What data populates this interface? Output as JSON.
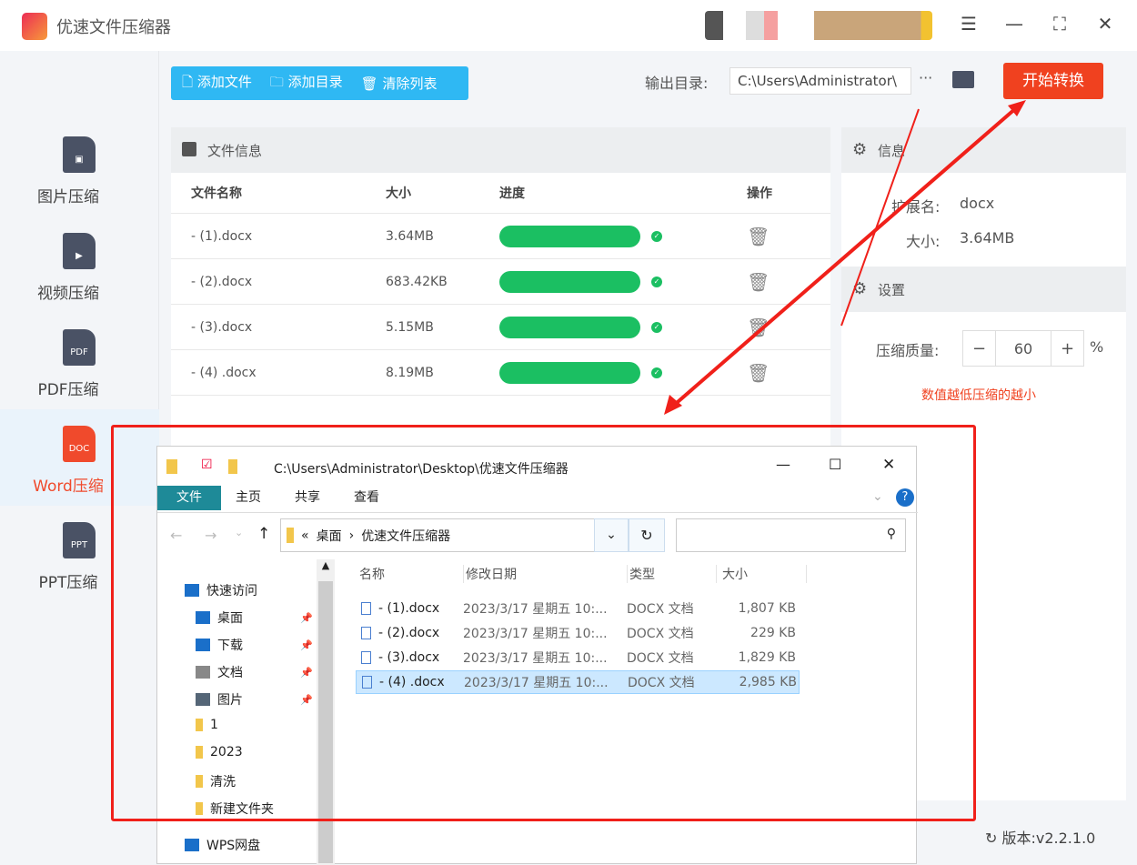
{
  "app": {
    "title": "优速文件压缩器"
  },
  "sidebar": {
    "items": [
      {
        "label": "图片压缩",
        "icon": "image-file-icon",
        "badge": ""
      },
      {
        "label": "视频压缩",
        "icon": "video-file-icon",
        "badge": ""
      },
      {
        "label": "PDF压缩",
        "icon": "pdf-file-icon",
        "badge": "PDF"
      },
      {
        "label": "Word压缩",
        "icon": "doc-file-icon",
        "badge": "DOC"
      },
      {
        "label": "PPT压缩",
        "icon": "ppt-file-icon",
        "badge": "PPT"
      }
    ]
  },
  "toolbar": {
    "add_file": "添加文件",
    "add_folder": "添加目录",
    "clear_list": "清除列表",
    "output_label": "输出目录:",
    "output_path": "C:\\Users\\Administrator\\",
    "more": "···",
    "start": "开始转换"
  },
  "file_panel": {
    "title": "文件信息",
    "columns": [
      "文件名称",
      "大小",
      "进度",
      "操作"
    ],
    "rows": [
      {
        "name": "- (1).docx",
        "size": "3.64MB",
        "progress": 100
      },
      {
        "name": "- (2).docx",
        "size": "683.42KB",
        "progress": 100
      },
      {
        "name": "- (3).docx",
        "size": "5.15MB",
        "progress": 100
      },
      {
        "name": "- (4) .docx",
        "size": "8.19MB",
        "progress": 100
      }
    ]
  },
  "info": {
    "title": "信息",
    "ext_label": "扩展名:",
    "ext": "docx",
    "size_label": "大小:",
    "size": "3.64MB"
  },
  "settings": {
    "title": "设置",
    "quality_label": "压缩质量:",
    "minus": "−",
    "quality": "60",
    "plus": "+",
    "unit": "%",
    "hint": "数值越低压缩的越小"
  },
  "version": "版本:v2.2.1.0",
  "explorer": {
    "title": "C:\\Users\\Administrator\\Desktop\\优速文件压缩器",
    "tabs": [
      "文件",
      "主页",
      "共享",
      "查看"
    ],
    "breadcrumb": [
      "«",
      "桌面",
      "›",
      "优速文件压缩器"
    ],
    "nav": [
      {
        "label": "快速访问"
      },
      {
        "label": "桌面"
      },
      {
        "label": "下载"
      },
      {
        "label": "文档"
      },
      {
        "label": "图片"
      },
      {
        "label": "1"
      },
      {
        "label": "2023"
      },
      {
        "label": "清洗"
      },
      {
        "label": "新建文件夹"
      },
      {
        "label": "WPS网盘"
      }
    ],
    "columns": [
      "名称",
      "修改日期",
      "类型",
      "大小"
    ],
    "files": [
      {
        "name": "- (1).docx",
        "date": "2023/3/17 星期五 10:...",
        "type": "DOCX 文档",
        "size": "1,807 KB"
      },
      {
        "name": "- (2).docx",
        "date": "2023/3/17 星期五 10:...",
        "type": "DOCX 文档",
        "size": "229 KB"
      },
      {
        "name": "- (3).docx",
        "date": "2023/3/17 星期五 10:...",
        "type": "DOCX 文档",
        "size": "1,829 KB"
      },
      {
        "name": "- (4) .docx",
        "date": "2023/3/17 星期五 10:...",
        "type": "DOCX 文档",
        "size": "2,985 KB"
      }
    ]
  },
  "colors": {
    "accent": "#2fb8f3",
    "start": "#f0411f",
    "progress": "#1bbf62",
    "annotation": "#f0201a"
  }
}
